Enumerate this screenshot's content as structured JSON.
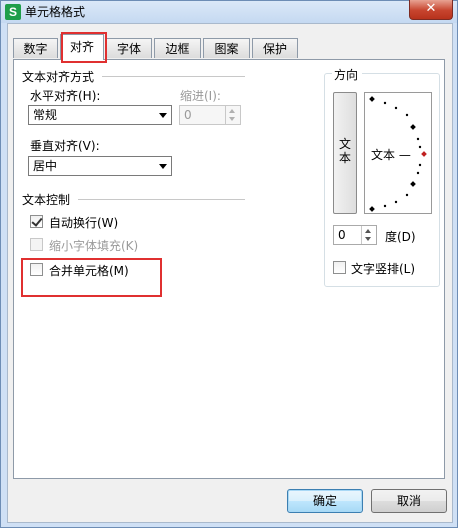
{
  "window": {
    "title": "单元格格式",
    "app_icon_letter": "S",
    "close_glyph": "✕"
  },
  "tabs": [
    {
      "label": "数字",
      "active": false
    },
    {
      "label": "对齐",
      "active": true
    },
    {
      "label": "字体",
      "active": false
    },
    {
      "label": "边框",
      "active": false
    },
    {
      "label": "图案",
      "active": false
    },
    {
      "label": "保护",
      "active": false
    }
  ],
  "alignment": {
    "section_title": "文本对齐方式",
    "horizontal_label": "水平对齐(H):",
    "horizontal_value": "常规",
    "indent_label": "缩进(I):",
    "indent_value": "0",
    "vertical_label": "垂直对齐(V):",
    "vertical_value": "居中"
  },
  "text_control": {
    "section_title": "文本控制",
    "wrap_text_label": "自动换行(W)",
    "wrap_text_checked": true,
    "shrink_to_fit_label": "缩小字体填充(K)",
    "shrink_to_fit_checked": false,
    "shrink_to_fit_enabled": false,
    "merge_cells_label": "合并单元格(M)",
    "merge_cells_checked": false
  },
  "orientation": {
    "section_title": "方向",
    "vertical_text_button": "文本",
    "preview_text": "文本 —",
    "degrees_value": "0",
    "degrees_label": "度(D)",
    "vertical_stack_label": "文字竖排(L)",
    "vertical_stack_checked": false
  },
  "footer": {
    "ok_label": "确定",
    "cancel_label": "取消"
  },
  "colors": {
    "highlight_red": "#e03030",
    "active_marker": "#c02020"
  }
}
